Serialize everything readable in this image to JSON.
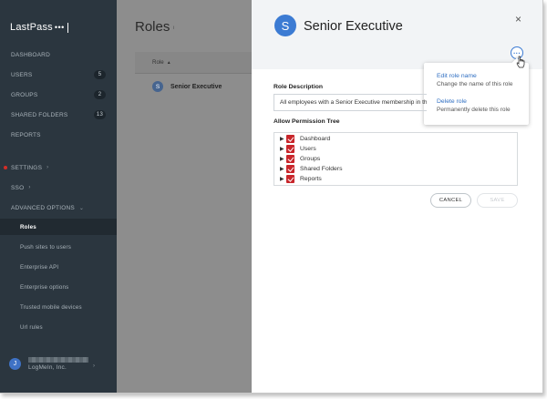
{
  "sidebar": {
    "logo_text": "LastPass",
    "logo_dots": "•••",
    "items": [
      {
        "label": "DASHBOARD",
        "badge": ""
      },
      {
        "label": "USERS",
        "badge": "5"
      },
      {
        "label": "GROUPS",
        "badge": "2"
      },
      {
        "label": "SHARED FOLDERS",
        "badge": "13"
      },
      {
        "label": "REPORTS",
        "badge": ""
      },
      {
        "label": "SETTINGS",
        "badge": ""
      },
      {
        "label": "SSO",
        "badge": ""
      },
      {
        "label": "ADVANCED OPTIONS",
        "badge": ""
      }
    ],
    "sub_items": [
      {
        "label": "Roles",
        "active": true
      },
      {
        "label": "Push sites to users"
      },
      {
        "label": "Enterprise API"
      },
      {
        "label": "Enterprise options"
      },
      {
        "label": "Trusted mobile devices"
      },
      {
        "label": "Url rules"
      }
    ],
    "user": {
      "initial": "J",
      "company": "LogMeIn, Inc."
    }
  },
  "main": {
    "title": "Roles",
    "column_header": "Role",
    "rows": [
      {
        "initial": "S",
        "name": "Senior Executive"
      }
    ]
  },
  "panel": {
    "avatar_initial": "S",
    "title": "Senior Executive",
    "close_glyph": "×",
    "more_glyph": "···",
    "menu": [
      {
        "title": "Edit role name",
        "desc": "Change the name of this role"
      },
      {
        "title": "Delete role",
        "desc": "Permanently delete this role"
      }
    ],
    "description_label": "Role Description",
    "description_value": "All employees with a Senior Executive membership in the",
    "tree_label": "Allow Permission Tree",
    "tree_items": [
      "Dashboard",
      "Users",
      "Groups",
      "Shared Folders",
      "Reports"
    ],
    "cancel_label": "CANCEL",
    "save_label": "SAVE"
  },
  "colors": {
    "sidebar_bg": "#2b363f",
    "accent_blue": "#3c7bd3",
    "checkbox_red": "#c8262b",
    "alert_red": "#d32d27"
  }
}
